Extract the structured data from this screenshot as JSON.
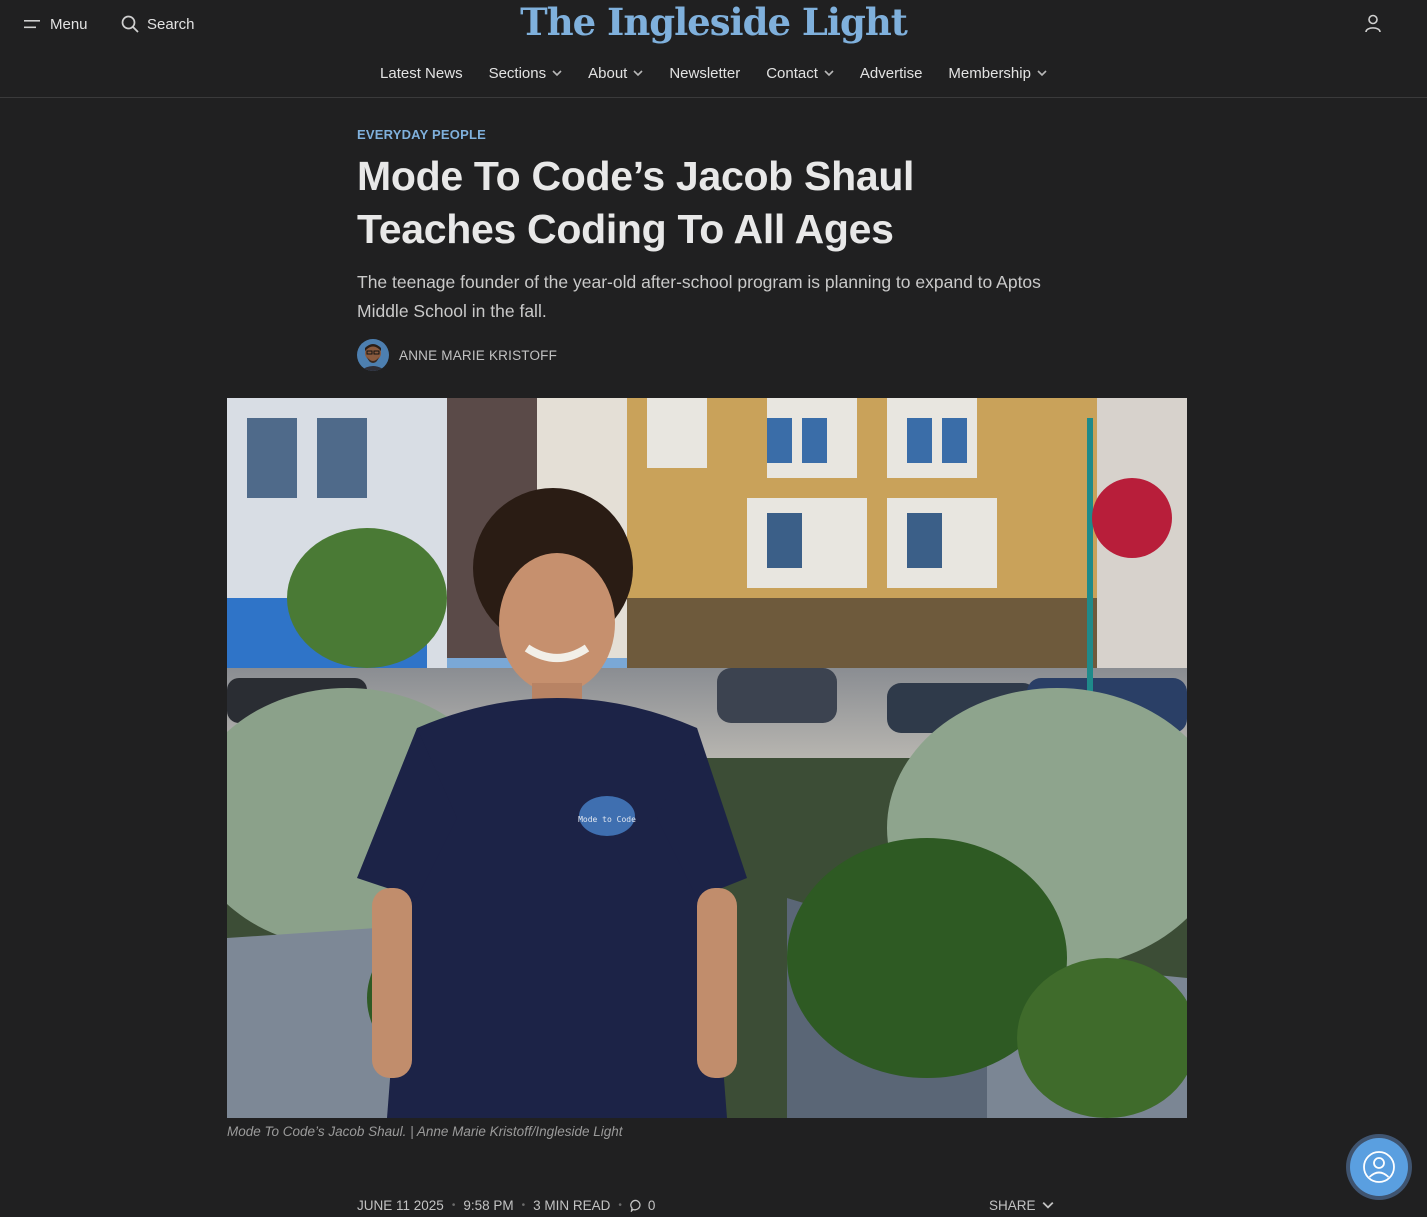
{
  "header": {
    "menu_label": "Menu",
    "search_label": "Search",
    "logo_text": "The Ingleside Light"
  },
  "nav": {
    "items": [
      {
        "label": "Latest News",
        "dropdown": false
      },
      {
        "label": "Sections",
        "dropdown": true
      },
      {
        "label": "About",
        "dropdown": true
      },
      {
        "label": "Newsletter",
        "dropdown": false
      },
      {
        "label": "Contact",
        "dropdown": true
      },
      {
        "label": "Advertise",
        "dropdown": false
      },
      {
        "label": "Membership",
        "dropdown": true
      }
    ]
  },
  "article": {
    "kicker": "EVERYDAY PEOPLE",
    "title_line1": "Mode To Code’s Jacob Shaul",
    "title_line2": "Teaches Coding To All Ages",
    "dek": "The teenage founder of the year-old after-school program is planning to expand to Aptos Middle School in the fall.",
    "author": "ANNE MARIE KRISTOFF",
    "image_shirt_text": "Mode to Code",
    "caption": "Mode To Code’s Jacob Shaul. | Anne Marie Kristoff/Ingleside Light",
    "date": "JUNE 11 2025",
    "time": "9:58 PM",
    "read_time": "3 MIN READ",
    "comment_count": "0",
    "share_label": "SHARE"
  },
  "colors": {
    "background": "#202021",
    "accent": "#7fb0dc",
    "fab": "#5a9fe0"
  },
  "icons": {
    "menu": "hamburger-icon",
    "search": "search-icon",
    "account": "user-icon",
    "dropdown": "chevron-down-icon",
    "comment": "comment-icon",
    "fab": "user-circle-icon"
  }
}
